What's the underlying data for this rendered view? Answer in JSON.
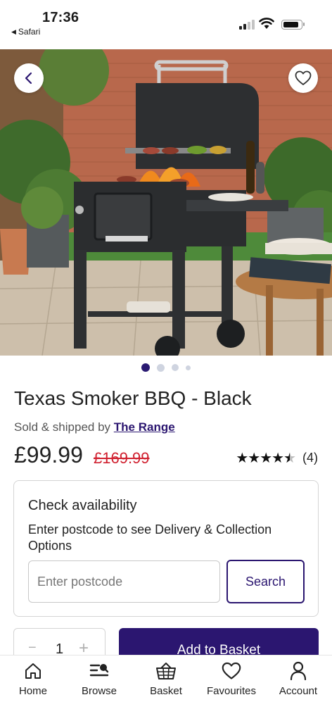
{
  "status_bar": {
    "time": "17:36",
    "back_app": "Safari"
  },
  "product": {
    "title": "Texas Smoker BBQ - Black",
    "seller_prefix": "Sold & shipped by",
    "seller_name": "The Range",
    "price": "£99.99",
    "old_price": "£169.99",
    "rating": 4.5,
    "review_count": "(4)"
  },
  "gallery": {
    "current_page": 1,
    "total_pages": 4
  },
  "availability": {
    "heading": "Check availability",
    "description": "Enter postcode to see Delivery & Collection Options",
    "postcode_placeholder": "Enter postcode",
    "search_label": "Search"
  },
  "purchase": {
    "quantity": "1",
    "minus_symbol": "−",
    "plus_symbol": "+",
    "add_label": "Add to Basket"
  },
  "tabbar": {
    "items": [
      {
        "label": "Home",
        "icon": "home-icon"
      },
      {
        "label": "Browse",
        "icon": "browse-icon"
      },
      {
        "label": "Basket",
        "icon": "basket-icon"
      },
      {
        "label": "Favourites",
        "icon": "heart-icon"
      },
      {
        "label": "Account",
        "icon": "account-icon"
      }
    ]
  },
  "colors": {
    "brand": "#2b1670",
    "sale": "#d0202f"
  }
}
